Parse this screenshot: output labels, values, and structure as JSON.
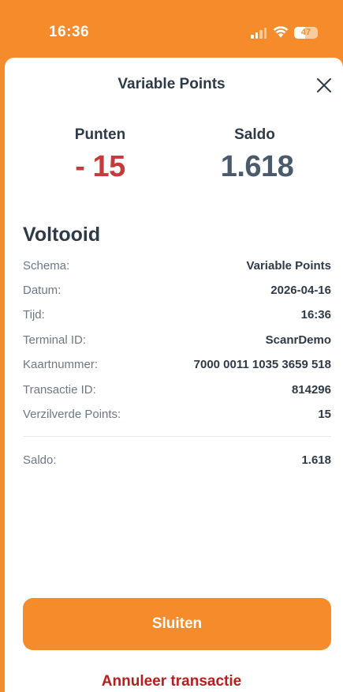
{
  "status_bar": {
    "time": "16:36",
    "battery": "47",
    "battery_level": 0.47
  },
  "header": {
    "title": "Variable Points",
    "close_icon": "close-icon"
  },
  "summary": {
    "points_label": "Punten",
    "points_value": "- 15",
    "balance_label": "Saldo",
    "balance_value": "1.618"
  },
  "details": {
    "status": "Voltooid",
    "rows": [
      {
        "label": "Schema:",
        "value": "Variable Points"
      },
      {
        "label": "Datum:",
        "value": "2026-04-16"
      },
      {
        "label": "Tijd:",
        "value": "16:36"
      },
      {
        "label": "Terminal ID:",
        "value": "ScanrDemo"
      },
      {
        "label": "Kaartnummer:",
        "value": "7000 0011 1035 3659 518"
      },
      {
        "label": "Transactie ID:",
        "value": "814296"
      },
      {
        "label": "Verzilverde Points:",
        "value": "15"
      }
    ],
    "total": {
      "label": "Saldo:",
      "value": "1.618"
    }
  },
  "actions": {
    "close_label": "Sluiten",
    "cancel_label": "Annuleer transactie"
  },
  "colors": {
    "accent": "#f58b2b",
    "negative": "#c53a3a",
    "cancel": "#b22020",
    "balance": "#4b5a6a"
  }
}
